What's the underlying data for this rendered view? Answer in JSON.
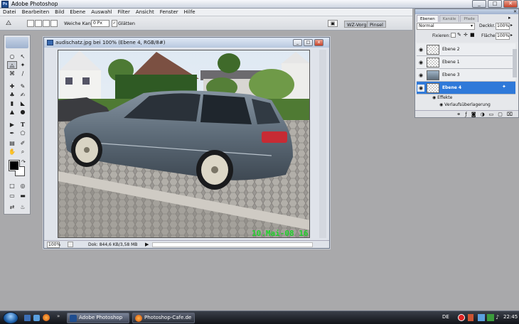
{
  "app": {
    "title": "Adobe Photoshop"
  },
  "menu": [
    "Datei",
    "Bearbeiten",
    "Bild",
    "Ebene",
    "Auswahl",
    "Filter",
    "Ansicht",
    "Fenster",
    "Hilfe"
  ],
  "options": {
    "feather_label": "Weiche Kante:",
    "feather_value": "0 Px",
    "antialias_label": "Glätten",
    "wz_tab": "WZ-Vorg.",
    "brush_tab": "Pinsel"
  },
  "document": {
    "title": "audischatz.jpg bei 100% (Ebene 4, RGB/8#)",
    "zoom": "100%",
    "doc_info": "Dok: 844,6 KB/3,58 MB",
    "photo_stamp": "10.Mai-08 16:16"
  },
  "layers_panel": {
    "tabs": [
      "Ebenen",
      "Kanäle",
      "Pfade"
    ],
    "blend_mode": "Normal",
    "opacity_label": "Deckkr.:",
    "opacity_value": "100%",
    "lock_label": "Fixieren:",
    "fill_label": "Fläche:",
    "fill_value": "100%",
    "layers": [
      {
        "name": "Ebene 2",
        "selected": false
      },
      {
        "name": "Ebene 1",
        "selected": false
      },
      {
        "name": "Ebene 3",
        "selected": false
      },
      {
        "name": "Ebene 4",
        "selected": true
      }
    ],
    "effects_label": "Effekte",
    "effect_item": "Verlaufsüberlagerung"
  },
  "taskbar": {
    "tasks": [
      "Adobe Photoshop",
      "Photoshop-Cafe.de ..."
    ],
    "lang": "DE",
    "clock": "22:45"
  }
}
